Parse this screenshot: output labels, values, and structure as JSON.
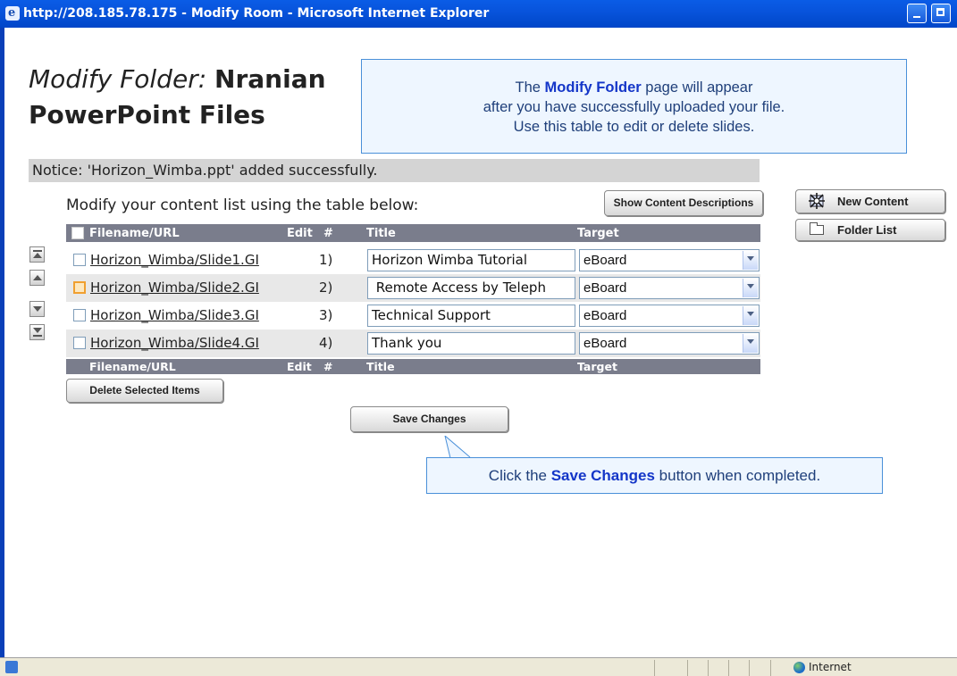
{
  "window": {
    "title": "http://208.185.78.175 - Modify Room - Microsoft Internet Explorer"
  },
  "page": {
    "heading_prefix": "Modify Folder:",
    "heading_name_line1": "Nranian",
    "heading_name_line2": "PowerPoint Files",
    "notice": "Notice: 'Horizon_Wimba.ppt' added successfully.",
    "modify_label": "Modify your content list using the table below:"
  },
  "buttons": {
    "show_descriptions": "Show Content Descriptions",
    "new_content": "New Content",
    "folder_list": "Folder List",
    "delete_selected": "Delete Selected Items",
    "save_changes": "Save Changes"
  },
  "table": {
    "headers": {
      "filename": "Filename/URL",
      "edit": "Edit",
      "num": "#",
      "title": "Title",
      "target": "Target"
    },
    "rows": [
      {
        "filename": "Horizon_Wimba/Slide1.GI",
        "num": "1)",
        "title": "Horizon Wimba Tutorial",
        "target": "eBoard"
      },
      {
        "filename": "Horizon_Wimba/Slide2.GI",
        "num": "2)",
        "title": " Remote Access by Teleph",
        "target": "eBoard"
      },
      {
        "filename": "Horizon_Wimba/Slide3.GI",
        "num": "3)",
        "title": "Technical Support",
        "target": "eBoard"
      },
      {
        "filename": "Horizon_Wimba/Slide4.GI",
        "num": "4)",
        "title": "Thank you",
        "target": "eBoard"
      }
    ]
  },
  "callouts": {
    "top_line1_pre": "The ",
    "top_line1_bold": "Modify Folder",
    "top_line1_post": " page will appear",
    "top_line2": "after you have successfully uploaded your file.",
    "top_line3": "Use this table to edit or delete slides.",
    "bottom_pre": "Click the ",
    "bottom_bold": "Save Changes",
    "bottom_post": " button when completed."
  },
  "statusbar": {
    "zone": "Internet"
  },
  "icons": {
    "move_top": "move-top-icon",
    "move_up": "move-up-icon",
    "move_down": "move-down-icon",
    "move_bottom": "move-bottom-icon"
  },
  "colors": {
    "titlebar": "#0854dc",
    "table_header": "#7a7d8c",
    "callout_border": "#4a90d9",
    "callout_emphasis": "#1436c8"
  }
}
